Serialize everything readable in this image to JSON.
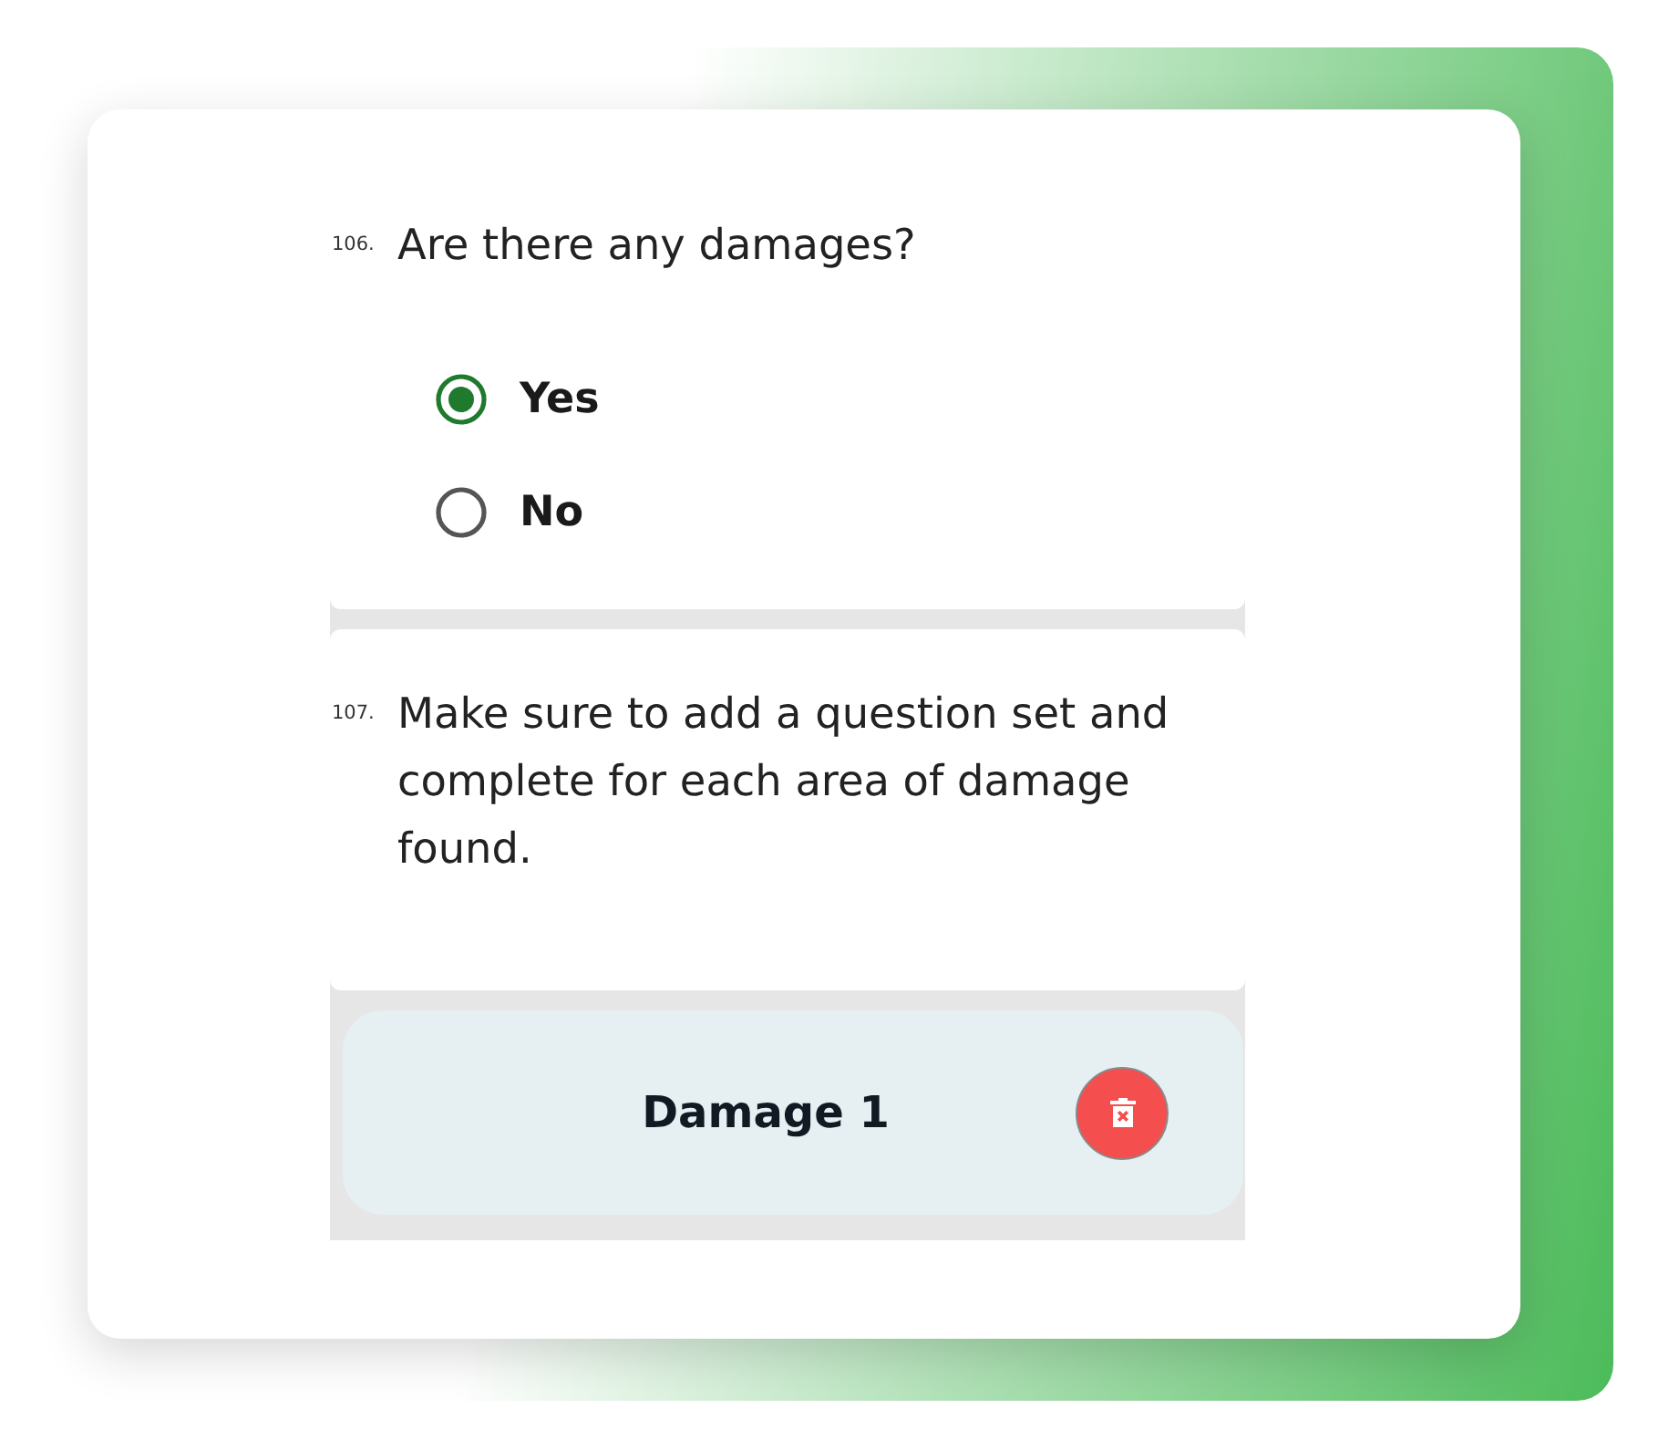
{
  "questions": [
    {
      "number": "106.",
      "text": "Are there any damages?",
      "kind": "choice",
      "options": [
        {
          "label": "Yes",
          "selected": true
        },
        {
          "label": "No",
          "selected": false
        }
      ]
    },
    {
      "number": "107.",
      "text": "Make sure to add a question set and complete for each area of damage found.",
      "kind": "note"
    }
  ],
  "question_sets": [
    {
      "title": "Damage 1"
    }
  ]
}
